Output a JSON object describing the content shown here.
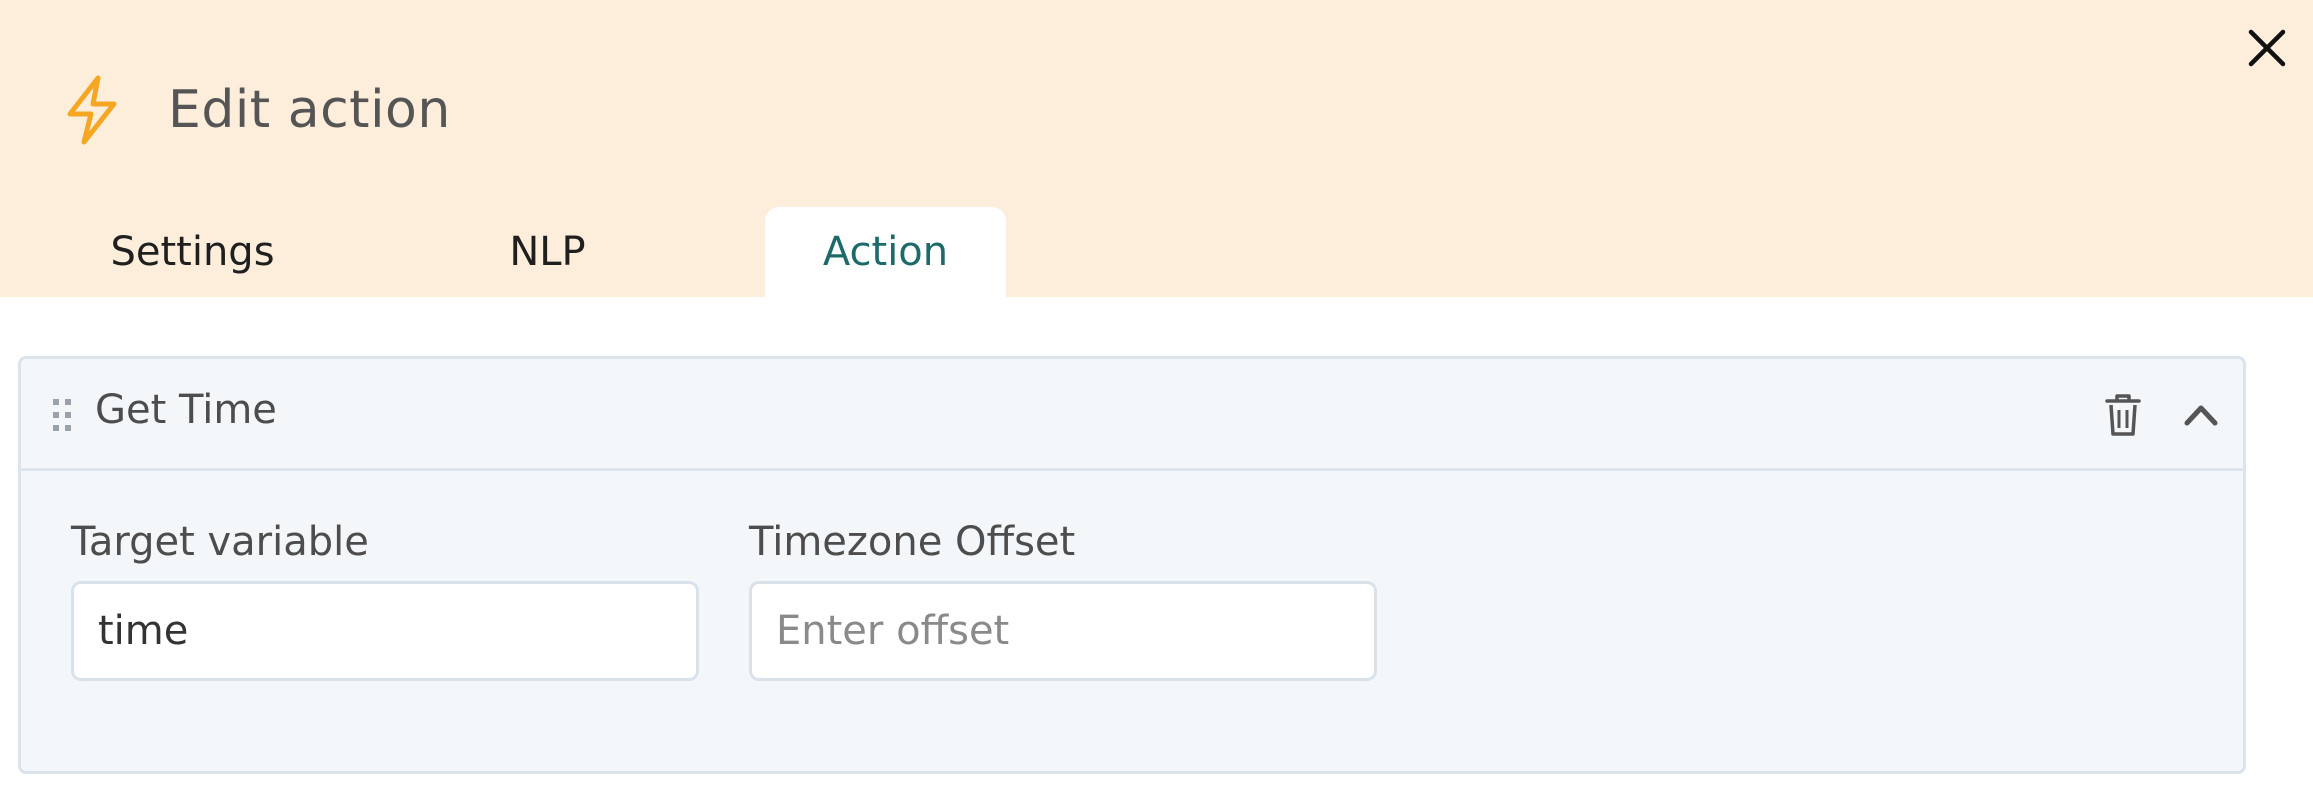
{
  "header": {
    "title": "Edit action",
    "icon": "lightning-bolt-icon",
    "close_icon": "close-icon",
    "accent_color": "#f5a623",
    "background": "#fdeedc"
  },
  "tabs": [
    {
      "label": "Settings",
      "active": false
    },
    {
      "label": "NLP",
      "active": false
    },
    {
      "label": "Action",
      "active": true
    }
  ],
  "action_card": {
    "title": "Get Time",
    "drag_icon": "drag-handle-icon",
    "delete_icon": "trash-icon",
    "collapse_icon": "chevron-up-icon",
    "fields": {
      "target_variable": {
        "label": "Target variable",
        "value": "time",
        "placeholder": ""
      },
      "timezone_offset": {
        "label": "Timezone Offset",
        "value": "",
        "placeholder": "Enter offset"
      }
    }
  },
  "colors": {
    "active_tab_text": "#1e6a6b",
    "card_background": "#f4f7fa",
    "card_border": "#dbe4ec"
  }
}
